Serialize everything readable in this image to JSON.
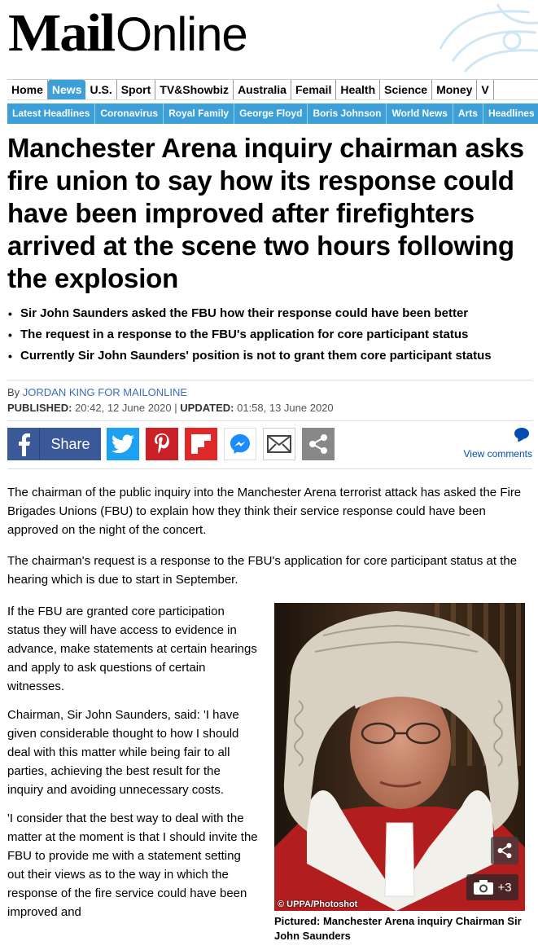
{
  "masthead": {
    "logo_mail": "Mail",
    "logo_online": "Online"
  },
  "nav": {
    "primary": [
      "Home",
      "News",
      "U.S.",
      "Sport",
      "TV&Showbiz",
      "Australia",
      "Femail",
      "Health",
      "Science",
      "Money",
      "V"
    ],
    "active": "News",
    "secondary": [
      "Latest Headlines",
      "Coronavirus",
      "Royal Family",
      "George Floyd",
      "Boris Johnson",
      "World News",
      "Arts",
      "Headlines"
    ]
  },
  "article": {
    "headline": "Manchester Arena inquiry chairman asks fire union to say how its response could have been improved after firefighters arrived at the scene two hours following the explosion",
    "bullets": [
      "Sir John Saunders asked the FBU how their response could have been better",
      "The request in a response to the FBU's application for core participant status",
      "Currently  Sir John Saunders' position is not to grant them core participant status"
    ],
    "byline_prefix": "By",
    "author": "JORDAN KING FOR MAILONLINE",
    "published_label": "PUBLISHED:",
    "published": "20:42, 12 June 2020",
    "separator": "|",
    "updated_label": "UPDATED:",
    "updated": "01:58, 13 June 2020",
    "paragraphs": [
      "The chairman of the public inquiry into the Manchester Arena terrorist attack has asked the Fire Brigades Unions (FBU) to explain how they think their service response could have been approved on the night of the concert.",
      "The chairman's request is a response to the FBU's application for core participant status at the hearing which is due to start in September.",
      "If the FBU are granted core participation status they will have access to evidence in advance, make statements at certain hearings and apply to ask questions of certain witnesses.",
      "Chairman, Sir John Saunders, said: 'I have given considerable thought to how I should deal with this matter while being fair to all parties, achieving the best result for the inquiry and avoiding unnecessary costs.",
      "'I consider that the best way to deal with the matter at the moment is that I should invite the FBU to provide me with a statement setting out their views as to the way in which the response of the fire service could have been improved and"
    ]
  },
  "share": {
    "share_label": "Share",
    "view_comments": "View comments",
    "icons": [
      "facebook-icon",
      "twitter-icon",
      "pinterest-icon",
      "flipboard-icon",
      "messenger-icon",
      "email-icon",
      "share-more-icon"
    ]
  },
  "figure": {
    "credit": "© UPPA/Photoshot",
    "gallery_count": "+3",
    "caption": "Pictured: Manchester Arena inquiry Chairman Sir John Saunders"
  },
  "colors": {
    "nav_blue": "#3c9fd8",
    "facebook": "#3b5998",
    "twitter": "#1da1f2",
    "pinterest": "#cb2027",
    "flipboard": "#e12828",
    "link_blue": "#004db3"
  }
}
